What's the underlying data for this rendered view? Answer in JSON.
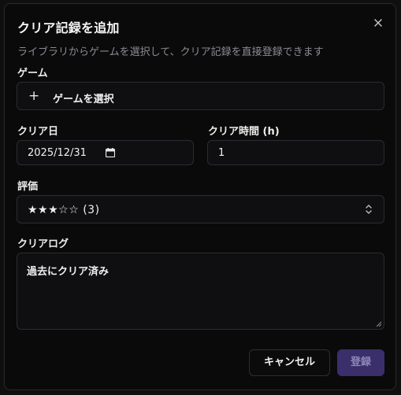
{
  "dialog": {
    "title": "クリア記録を追加",
    "description": "ライブラリからゲームを選択して、クリア記録を直接登録できます",
    "close_icon": "close-icon"
  },
  "game": {
    "label": "ゲーム",
    "button_icon": "plus-icon",
    "button_label": "ゲームを選択"
  },
  "clear_date": {
    "label": "クリア日",
    "value": "2025/12/31",
    "icon": "calendar-icon"
  },
  "clear_time": {
    "label": "クリア時間 (h)",
    "value": "1"
  },
  "rating": {
    "label": "評価",
    "value": "★★★☆☆ (3)",
    "icon": "chevron-up-down-icon"
  },
  "clear_log": {
    "label": "クリアログ",
    "value": "過去にクリア済み"
  },
  "actions": {
    "cancel_label": "キャンセル",
    "submit_label": "登録"
  },
  "colors": {
    "background": "#0a0a0b",
    "field_border": "#2c2c31",
    "submit_bg": "#3a2f6b",
    "submit_text": "#8e88b8"
  }
}
